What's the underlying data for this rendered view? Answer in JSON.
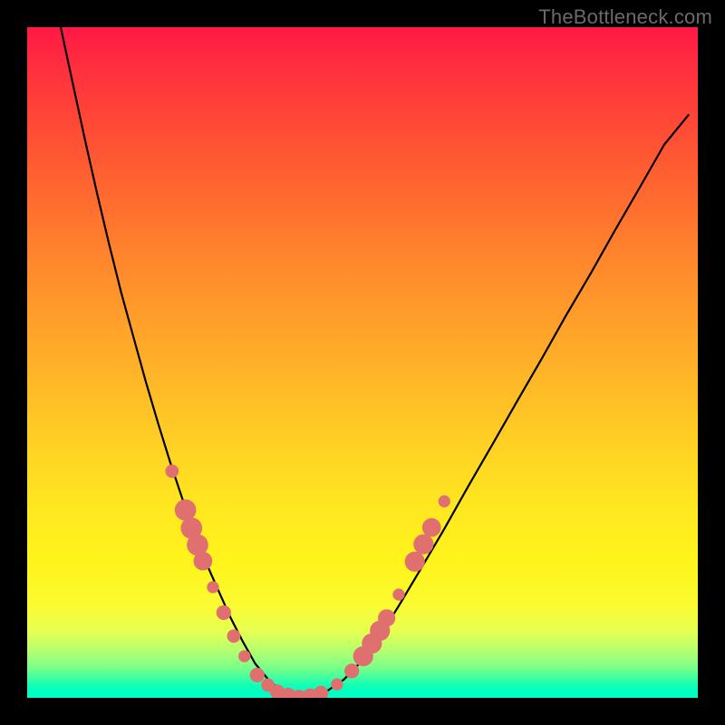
{
  "watermark": "TheBottleneck.com",
  "colors": {
    "frame": "#000000",
    "curve": "#000000",
    "marker": "#e07070"
  },
  "chart_data": {
    "type": "line",
    "title": "",
    "xlabel": "",
    "ylabel": "",
    "xlim": [
      0,
      100
    ],
    "ylim": [
      0,
      100
    ],
    "note": "Values estimated from pixel positions; axes are unlabeled in the source image. y=0 is bottom (green), y=100 is top (red). Curve depicts a bottleneck-style V shape.",
    "series": [
      {
        "name": "curve",
        "x": [
          5.0,
          6.8,
          8.6,
          10.4,
          12.2,
          14.0,
          15.9,
          17.7,
          19.5,
          21.3,
          23.1,
          24.9,
          26.7,
          28.6,
          30.4,
          32.2,
          34.0,
          36.3,
          39.0,
          41.7,
          44.4,
          47.2,
          49.9,
          52.6,
          55.4,
          58.5,
          62.2,
          65.8,
          69.5,
          73.1,
          76.8,
          80.4,
          84.1,
          87.7,
          91.4,
          95.0,
          98.6
        ],
        "y": [
          100.0,
          91.6,
          83.3,
          75.3,
          67.7,
          60.5,
          53.6,
          47.1,
          41.0,
          35.2,
          29.8,
          24.8,
          20.1,
          15.8,
          11.8,
          8.3,
          5.1,
          2.3,
          0.4,
          0.0,
          0.8,
          2.7,
          5.5,
          9.2,
          13.7,
          18.9,
          25.2,
          31.6,
          38.0,
          44.3,
          50.7,
          57.1,
          63.4,
          69.8,
          76.2,
          82.5,
          86.9
        ]
      }
    ],
    "markers": {
      "name": "highlighted-points",
      "shape": "circle",
      "note": "Salmon dots clustered near the minimum of the V curve; radii in plot-percent units.",
      "points": [
        {
          "x": 21.6,
          "y": 33.8,
          "r": 1.0
        },
        {
          "x": 23.6,
          "y": 28.0,
          "r": 1.6
        },
        {
          "x": 24.5,
          "y": 25.3,
          "r": 1.6
        },
        {
          "x": 25.4,
          "y": 22.8,
          "r": 1.6
        },
        {
          "x": 26.2,
          "y": 20.4,
          "r": 1.4
        },
        {
          "x": 27.7,
          "y": 16.5,
          "r": 0.9
        },
        {
          "x": 29.3,
          "y": 12.7,
          "r": 1.1
        },
        {
          "x": 30.8,
          "y": 9.2,
          "r": 1.0
        },
        {
          "x": 32.4,
          "y": 6.2,
          "r": 0.9
        },
        {
          "x": 34.3,
          "y": 3.4,
          "r": 1.1
        },
        {
          "x": 35.9,
          "y": 1.9,
          "r": 1.0
        },
        {
          "x": 37.3,
          "y": 0.9,
          "r": 1.1
        },
        {
          "x": 38.9,
          "y": 0.3,
          "r": 1.2
        },
        {
          "x": 40.5,
          "y": 0.0,
          "r": 1.2
        },
        {
          "x": 42.2,
          "y": 0.2,
          "r": 1.2
        },
        {
          "x": 43.8,
          "y": 0.7,
          "r": 1.1
        },
        {
          "x": 46.2,
          "y": 2.0,
          "r": 0.9
        },
        {
          "x": 48.4,
          "y": 4.0,
          "r": 1.1
        },
        {
          "x": 50.1,
          "y": 6.2,
          "r": 1.5
        },
        {
          "x": 51.4,
          "y": 8.1,
          "r": 1.5
        },
        {
          "x": 52.6,
          "y": 10.0,
          "r": 1.5
        },
        {
          "x": 53.6,
          "y": 11.9,
          "r": 1.3
        },
        {
          "x": 55.4,
          "y": 15.4,
          "r": 0.9
        },
        {
          "x": 57.8,
          "y": 20.3,
          "r": 1.5
        },
        {
          "x": 59.1,
          "y": 22.9,
          "r": 1.5
        },
        {
          "x": 60.3,
          "y": 25.4,
          "r": 1.4
        },
        {
          "x": 62.2,
          "y": 29.3,
          "r": 0.9
        }
      ]
    }
  }
}
